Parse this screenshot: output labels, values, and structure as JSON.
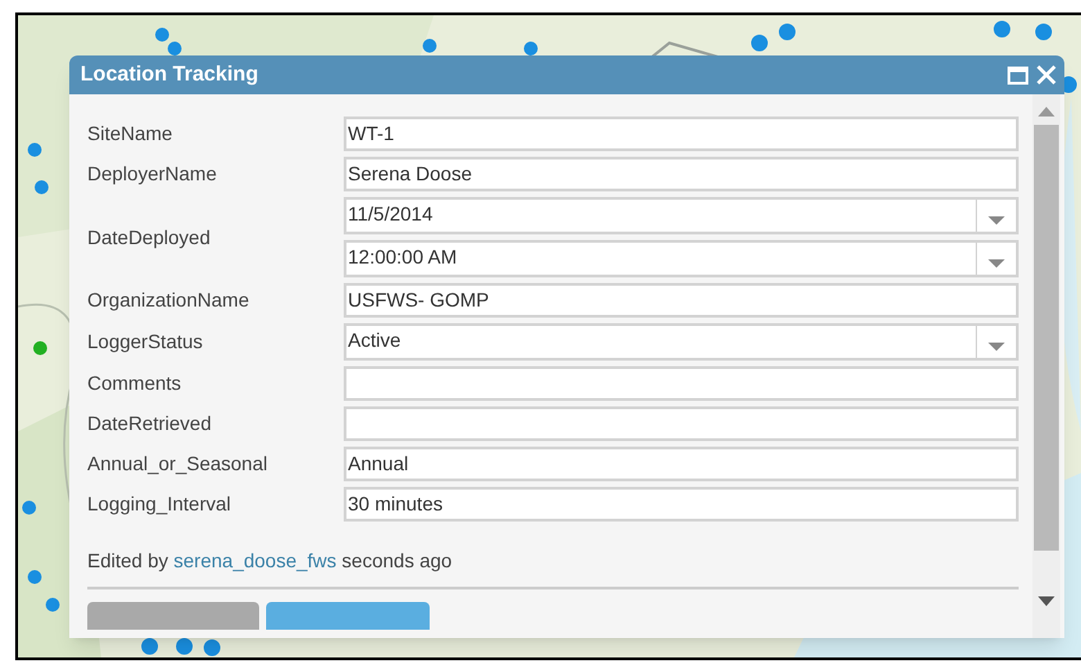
{
  "popup": {
    "title": "Location Tracking",
    "fields": [
      {
        "label": "SiteName",
        "inputs": [
          {
            "kind": "text",
            "value": "WT-1"
          }
        ]
      },
      {
        "label": "DeployerName",
        "inputs": [
          {
            "kind": "text",
            "value": "Serena Doose"
          }
        ]
      },
      {
        "label": "DateDeployed",
        "inputs": [
          {
            "kind": "dropdown",
            "value": "11/5/2014"
          },
          {
            "kind": "dropdown",
            "value": "12:00:00 AM"
          }
        ]
      },
      {
        "label": "OrganizationName",
        "inputs": [
          {
            "kind": "text",
            "value": "USFWS- GOMP"
          }
        ]
      },
      {
        "label": "LoggerStatus",
        "inputs": [
          {
            "kind": "dropdown",
            "value": "Active"
          }
        ]
      },
      {
        "label": "Comments",
        "inputs": [
          {
            "kind": "text"
          }
        ]
      },
      {
        "label": "DateRetrieved",
        "inputs": [
          {
            "kind": "text"
          }
        ]
      },
      {
        "label": "Annual_or_Seasonal",
        "inputs": [
          {
            "kind": "text",
            "value": "Annual"
          }
        ]
      },
      {
        "label": "Logging_Interval",
        "inputs": [
          {
            "kind": "text",
            "value": "30 minutes"
          }
        ]
      }
    ],
    "edit_info": {
      "prefix": "Edited by",
      "user": "serena_doose_fws",
      "suffix": "seconds ago"
    },
    "buttons": [
      {
        "kind": "delete"
      },
      {
        "kind": "close"
      }
    ]
  }
}
